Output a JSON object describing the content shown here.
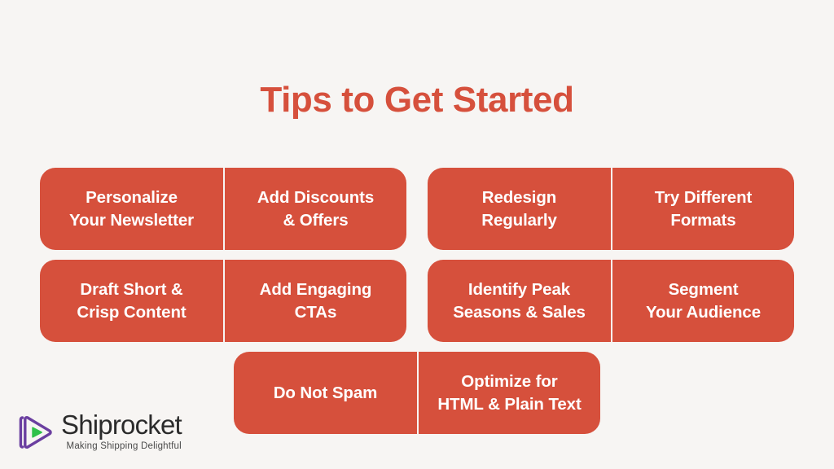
{
  "title": "Tips to Get Started",
  "theme": {
    "background": "#f7f5f3",
    "card": "#d6503c",
    "title_color": "#d6503c",
    "card_text": "#ffffff",
    "divider": "#f7f5f3",
    "logo_mark_purple": "#6b3fa0",
    "logo_mark_green": "#2fc14a",
    "logo_text": "#2b2b2b"
  },
  "rows": [
    {
      "groups": [
        {
          "cards": [
            {
              "label": "Personalize\nYour Newsletter"
            },
            {
              "label": "Add Discounts\n& Offers"
            }
          ]
        },
        {
          "cards": [
            {
              "label": "Redesign\nRegularly"
            },
            {
              "label": "Try Different\nFormats"
            }
          ]
        }
      ]
    },
    {
      "groups": [
        {
          "cards": [
            {
              "label": "Draft Short &\nCrisp Content"
            },
            {
              "label": "Add Engaging\nCTAs"
            }
          ]
        },
        {
          "cards": [
            {
              "label": "Identify Peak\nSeasons & Sales"
            },
            {
              "label": "Segment\nYour Audience"
            }
          ]
        }
      ]
    },
    {
      "groups": [
        {
          "cards": [
            {
              "label": "Do Not Spam"
            },
            {
              "label": "Optimize for\nHTML & Plain Text"
            }
          ]
        }
      ]
    }
  ],
  "logo": {
    "wordmark": "Shiprocket",
    "tagline": "Making Shipping Delightful",
    "mark_name": "shiprocket-play-mark"
  }
}
